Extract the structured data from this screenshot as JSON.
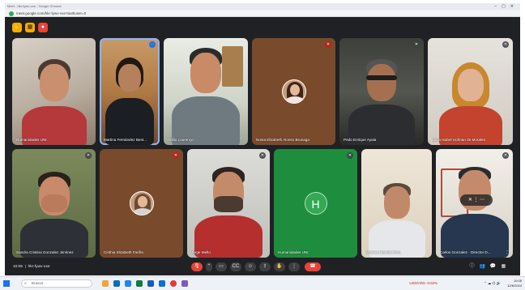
{
  "browser": {
    "title": "Meet - hkr-fywv-vxe - Google Chrome",
    "url": "meet.google.com/hkr-fywv-vxe?authuser=0"
  },
  "meeting": {
    "time": "10:05",
    "code": "hkr-fywv-vxe"
  },
  "participants": [
    {
      "name": "Humanidades UNI",
      "mic": "mic-muted-icon"
    },
    {
      "name": "Martina Fernández Bent...",
      "mic": "more-icon"
    },
    {
      "name": "Adilio Lourenço",
      "mic": ""
    },
    {
      "name": "Nonia Elizabeth Alonso Brunaga",
      "mic": "mic-muted-icon"
    },
    {
      "name": "Pedo Enrique Ayala",
      "mic": "mic-muted-icon"
    },
    {
      "name": "Lucia Isabel Hofman de Morales",
      "mic": "mic-muted-icon"
    },
    {
      "name": "Sandra Cristina Gonzalez Jiménez",
      "mic": "mic-muted-icon"
    },
    {
      "name": "Cinthia Elizabeth Fariña",
      "mic": "mic-muted-icon"
    },
    {
      "name": "Jorge Mello",
      "mic": "mic-muted-icon"
    },
    {
      "name": "Humanidades UNI",
      "mic": "mic-muted-icon",
      "avatar_letter": "H"
    },
    {
      "name": "Antonio Nicolás Pyrry",
      "mic": ""
    },
    {
      "name": "Carlos Gonzalez - Director D...",
      "mic": "mic-muted-icon"
    }
  ],
  "taskbar": {
    "search_placeholder": "Buscar",
    "weather": "USD/ARS -0.52%",
    "time": "10:05",
    "date": "12/6/2024"
  },
  "colors": {
    "meet_background": "#202124",
    "hangup": "#ea4335",
    "accent": "#f9ab00"
  }
}
